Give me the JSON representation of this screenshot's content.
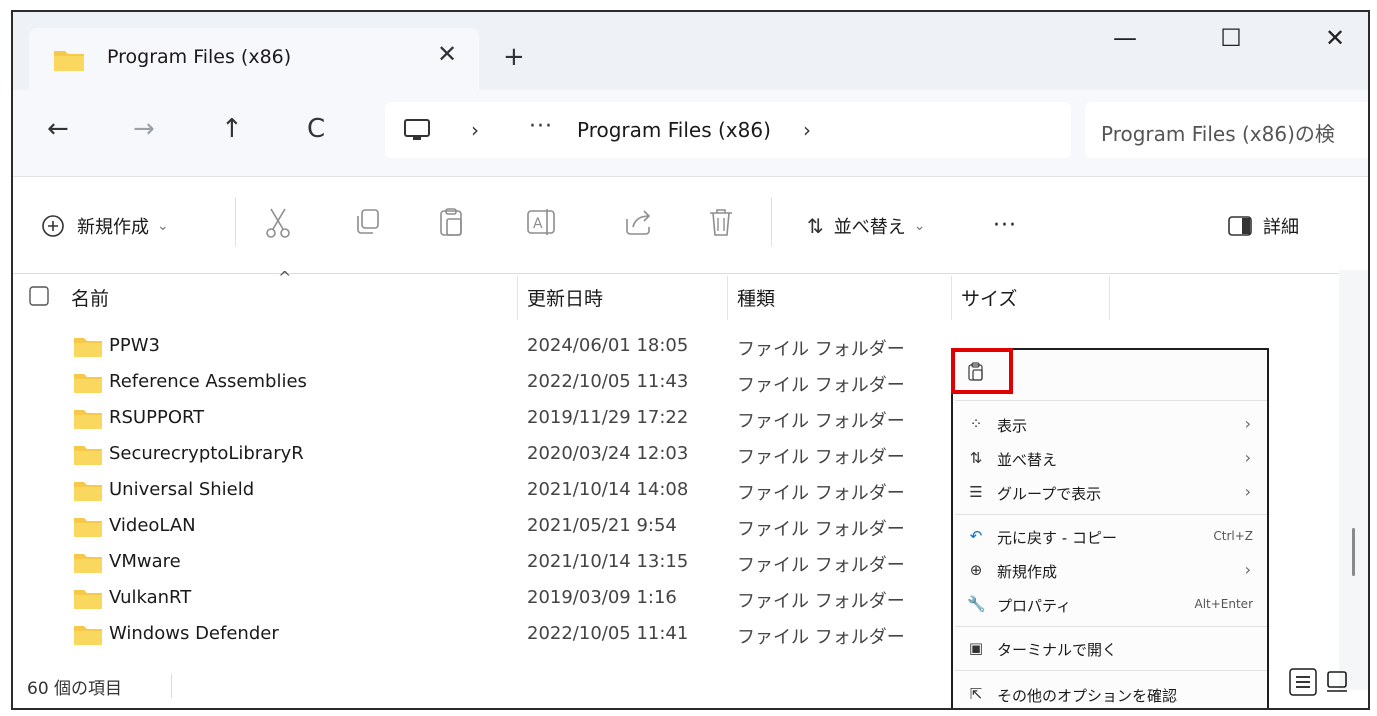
{
  "tab": {
    "title": "Program Files (x86)",
    "close": "✕",
    "new_tab": "+"
  },
  "window_controls": {
    "minimize": "—",
    "maximize": "☐",
    "close": "✕"
  },
  "nav": {
    "back": "←",
    "forward": "→",
    "up": "↑",
    "refresh": "C"
  },
  "address": {
    "chevron1": "›",
    "ellipsis": "···",
    "crumb": "Program Files (x86)",
    "chevron2": "›"
  },
  "search": {
    "placeholder": "Program Files (x86)の検"
  },
  "toolbar": {
    "new_label": "新規作成",
    "new_caret": "⌄",
    "sort_label": "並べ替え",
    "sort_caret": "⌄",
    "more": "···",
    "details_label": "詳細"
  },
  "columns": {
    "name": "名前",
    "date": "更新日時",
    "type": "種類",
    "size": "サイズ"
  },
  "files": [
    {
      "name": "PPW3",
      "date": "2024/06/01 18:05",
      "type": "ファイル フォルダー"
    },
    {
      "name": "Reference Assemblies",
      "date": "2022/10/05 11:43",
      "type": "ファイル フォルダー"
    },
    {
      "name": "RSUPPORT",
      "date": "2019/11/29 17:22",
      "type": "ファイル フォルダー"
    },
    {
      "name": "SecurecryptoLibraryR",
      "date": "2020/03/24 12:03",
      "type": "ファイル フォルダー"
    },
    {
      "name": "Universal Shield",
      "date": "2021/10/14 14:08",
      "type": "ファイル フォルダー"
    },
    {
      "name": "VideoLAN",
      "date": "2021/05/21 9:54",
      "type": "ファイル フォルダー"
    },
    {
      "name": "VMware",
      "date": "2021/10/14 13:15",
      "type": "ファイル フォルダー"
    },
    {
      "name": "VulkanRT",
      "date": "2019/03/09 1:16",
      "type": "ファイル フォルダー"
    },
    {
      "name": "Windows Defender",
      "date": "2022/10/05 11:41",
      "type": "ファイル フォルダー"
    }
  ],
  "status": {
    "count": "60 個の項目"
  },
  "context_menu": {
    "items": [
      {
        "icon": "view-icon",
        "glyph": "⁘",
        "label": "表示",
        "arrow": "›"
      },
      {
        "icon": "sort-icon",
        "glyph": "⇅",
        "label": "並べ替え",
        "arrow": "›"
      },
      {
        "icon": "group-icon",
        "glyph": "☰",
        "label": "グループで表示",
        "arrow": "›"
      },
      {
        "icon": "undo-icon",
        "glyph": "↶",
        "label": "元に戻す - コピー",
        "accel": "Ctrl+Z"
      },
      {
        "icon": "new-icon",
        "glyph": "⊕",
        "label": "新規作成",
        "arrow": "›"
      },
      {
        "icon": "properties-icon",
        "glyph": "🔧",
        "label": "プロパティ",
        "accel": "Alt+Enter"
      },
      {
        "icon": "terminal-icon",
        "glyph": "▣",
        "label": "ターミナルで開く"
      },
      {
        "icon": "more-options-icon",
        "glyph": "⇱",
        "label": "その他のオプションを確認"
      }
    ]
  },
  "colors": {
    "folder": "#f7c948",
    "accent": "#0067c0",
    "highlight": "#e00000",
    "undo_icon": "#0a6fcf"
  }
}
